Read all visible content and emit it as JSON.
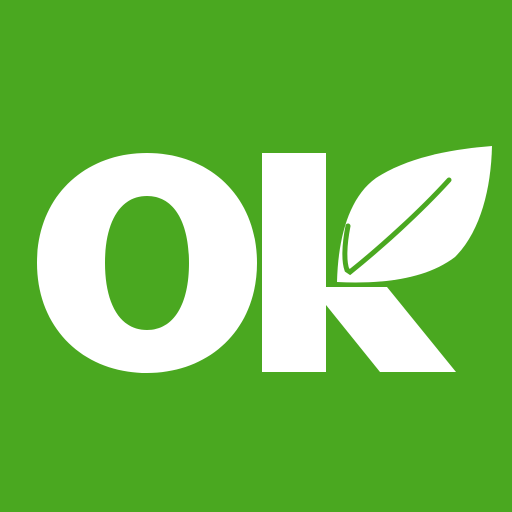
{
  "icon": {
    "name": "ok-leaf-logo",
    "lettering": "OK",
    "background_color": "#4aa820",
    "foreground_color": "#ffffff"
  }
}
